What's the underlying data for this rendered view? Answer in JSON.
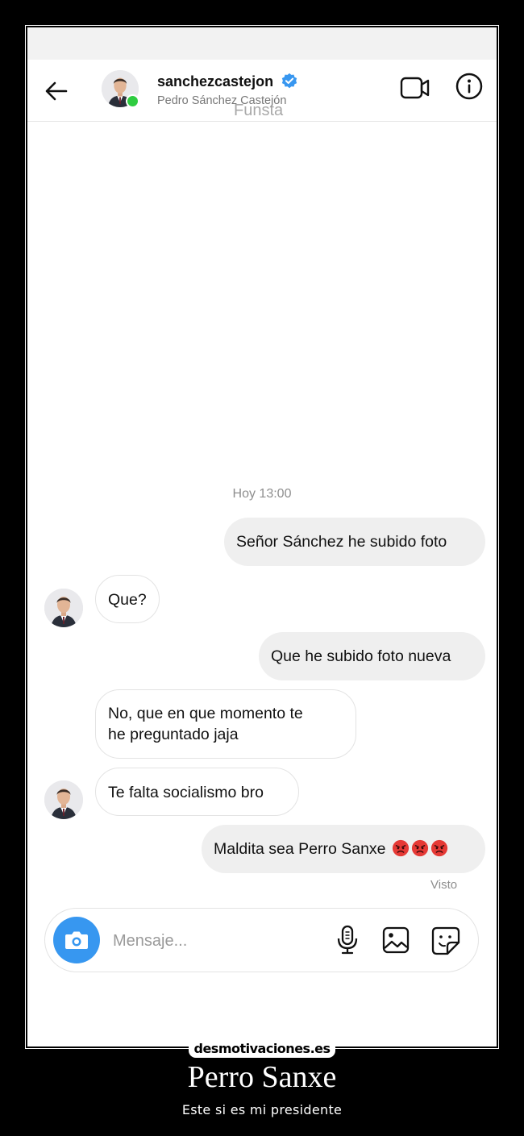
{
  "header": {
    "username": "sanchezcastejon",
    "full_name": "Pedro Sánchez Castejón",
    "overlay_text": "Funsta",
    "online": true
  },
  "chat": {
    "timestamp": "Hoy 13:00",
    "messages": [
      {
        "direction": "outgoing",
        "text": "Señor Sánchez he subido foto"
      },
      {
        "direction": "incoming",
        "text": "Que?"
      },
      {
        "direction": "outgoing",
        "text": "Que he subido foto nueva"
      },
      {
        "direction": "incoming",
        "lines": [
          "No, que en que momento te",
          "he preguntado jaja"
        ]
      },
      {
        "direction": "incoming",
        "text": "Te falta socialismo bro"
      },
      {
        "direction": "outgoing",
        "text": "Maldita sea Perro Sanxe",
        "emoji": [
          "😡",
          "😡",
          "😡"
        ]
      }
    ],
    "seen_label": "Visto"
  },
  "composer": {
    "placeholder": "Mensaje...",
    "value": ""
  },
  "poster": {
    "site": "desmotivaciones.es",
    "title": "Perro Sanxe",
    "subtitle": "Este si es mi presidente"
  },
  "colors": {
    "accent": "#3797f0",
    "online": "#2ecc40",
    "outgoing_bubble": "#efefef",
    "verified": "#3897f0",
    "angry_emoji": "#e53935"
  },
  "icons": [
    "back-arrow-icon",
    "verified-badge-icon",
    "video-call-icon",
    "info-icon",
    "camera-icon",
    "microphone-icon",
    "gallery-icon",
    "sticker-icon",
    "angry-face-emoji"
  ]
}
